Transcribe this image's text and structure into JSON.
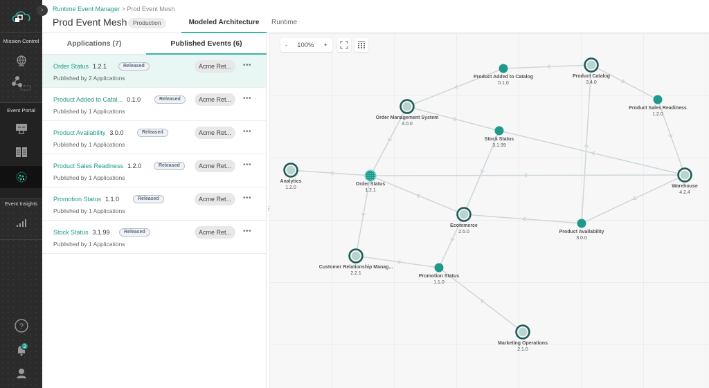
{
  "nav": {
    "sections": [
      {
        "label": "Mission Control",
        "items": [
          "globe-icon",
          "mesh-icon"
        ]
      },
      {
        "label": "Event Portal",
        "items": [
          "designer-icon",
          "catalog-icon",
          "runtime-icon"
        ]
      },
      {
        "label": "Event Insights",
        "items": [
          "insights-chart-icon"
        ]
      }
    ],
    "notification_count": "3"
  },
  "header": {
    "breadcrumb_root": "Runtime Event Manager",
    "breadcrumb_sep": ">",
    "breadcrumb_current": "Prod Event Mesh",
    "title": "Prod Event Mesh",
    "environment": "Production",
    "tabs": [
      {
        "label": "Modeled Architecture",
        "active": true
      },
      {
        "label": "Runtime",
        "active": false
      }
    ]
  },
  "panel": {
    "tabs": [
      {
        "label": "Applications (7)",
        "active": false
      },
      {
        "label": "Published Events (6)",
        "active": true
      }
    ],
    "events": [
      {
        "name": "Order Status",
        "version": "1.2.1",
        "status": "Released",
        "published_by": "Published by 2 Applications",
        "domain": "Acme Ret...",
        "selected": true
      },
      {
        "name": "Product Added to Catal...",
        "version": "0.1.0",
        "status": "Released",
        "published_by": "Published by 1 Applications",
        "domain": "Acme Ret...",
        "selected": false
      },
      {
        "name": "Product Availability",
        "version": "3.0.0",
        "status": "Released",
        "published_by": "Published by 1 Applications",
        "domain": "Acme Ret...",
        "selected": false
      },
      {
        "name": "Product Sales Readiness",
        "version": "1.2.0",
        "status": "Released",
        "published_by": "Published by 1 Applications",
        "domain": "Acme Ret...",
        "selected": false
      },
      {
        "name": "Promotion Status",
        "version": "1.1.0",
        "status": "Released",
        "published_by": "Published by 1 Applications",
        "domain": "Acme Ret...",
        "selected": false
      },
      {
        "name": "Stock Status",
        "version": "3.1.99",
        "status": "Released",
        "published_by": "Published by 1 Applications",
        "domain": "Acme Ret...",
        "selected": false
      }
    ],
    "more_label": "•••"
  },
  "canvas": {
    "zoom_out": "-",
    "zoom_level": "100%",
    "zoom_in": "+",
    "colors": {
      "accent": "#1f9a8a",
      "app_ring": "#1e5a57",
      "app_fill": "#b9d4ce",
      "edge": "#cdd6da"
    },
    "nodes": [
      {
        "id": "pac",
        "type": "event",
        "label": "Product Added to Catalog",
        "version": "0.1.0"
      },
      {
        "id": "pc",
        "type": "app",
        "label": "Product Catalog",
        "version": "3.4.0"
      },
      {
        "id": "psr",
        "type": "event",
        "label": "Product Sales Readiness",
        "version": "1.2.0"
      },
      {
        "id": "oms",
        "type": "app",
        "label": "Order Management System",
        "version": "4.0.0"
      },
      {
        "id": "ss",
        "type": "event",
        "label": "Stock Status",
        "version": "3.1.99"
      },
      {
        "id": "an",
        "type": "app",
        "label": "Analytics",
        "version": "1.2.0"
      },
      {
        "id": "os",
        "type": "event",
        "label": "Order Status",
        "version": "1.2.1",
        "selected": true
      },
      {
        "id": "wh",
        "type": "app",
        "label": "Warehouse",
        "version": "4.2.4"
      },
      {
        "id": "ec",
        "type": "app",
        "label": "Ecommerce",
        "version": "2.5.0"
      },
      {
        "id": "pa",
        "type": "event",
        "label": "Product Availability",
        "version": "3.0.0"
      },
      {
        "id": "crm",
        "type": "app",
        "label": "Customer Relationship Manag...",
        "version": "2.2.1"
      },
      {
        "id": "ps",
        "type": "event",
        "label": "Promotion Status",
        "version": "1.1.0"
      },
      {
        "id": "mo",
        "type": "app",
        "label": "Marketing Operations",
        "version": "2.1.0"
      }
    ],
    "edges": [
      [
        "pc",
        "pac"
      ],
      [
        "pac",
        "oms"
      ],
      [
        "pc",
        "psr"
      ],
      [
        "psr",
        "wh"
      ],
      [
        "ss",
        "oms"
      ],
      [
        "wh",
        "ss"
      ],
      [
        "ss",
        "ec"
      ],
      [
        "oms",
        "os"
      ],
      [
        "os",
        "an"
      ],
      [
        "os",
        "wh"
      ],
      [
        "ec",
        "os"
      ],
      [
        "os",
        "crm"
      ],
      [
        "wh",
        "pa"
      ],
      [
        "pa",
        "ec"
      ],
      [
        "pa",
        "pc"
      ],
      [
        "ec",
        "ps"
      ],
      [
        "ps",
        "crm"
      ],
      [
        "mo",
        "ps"
      ]
    ]
  }
}
